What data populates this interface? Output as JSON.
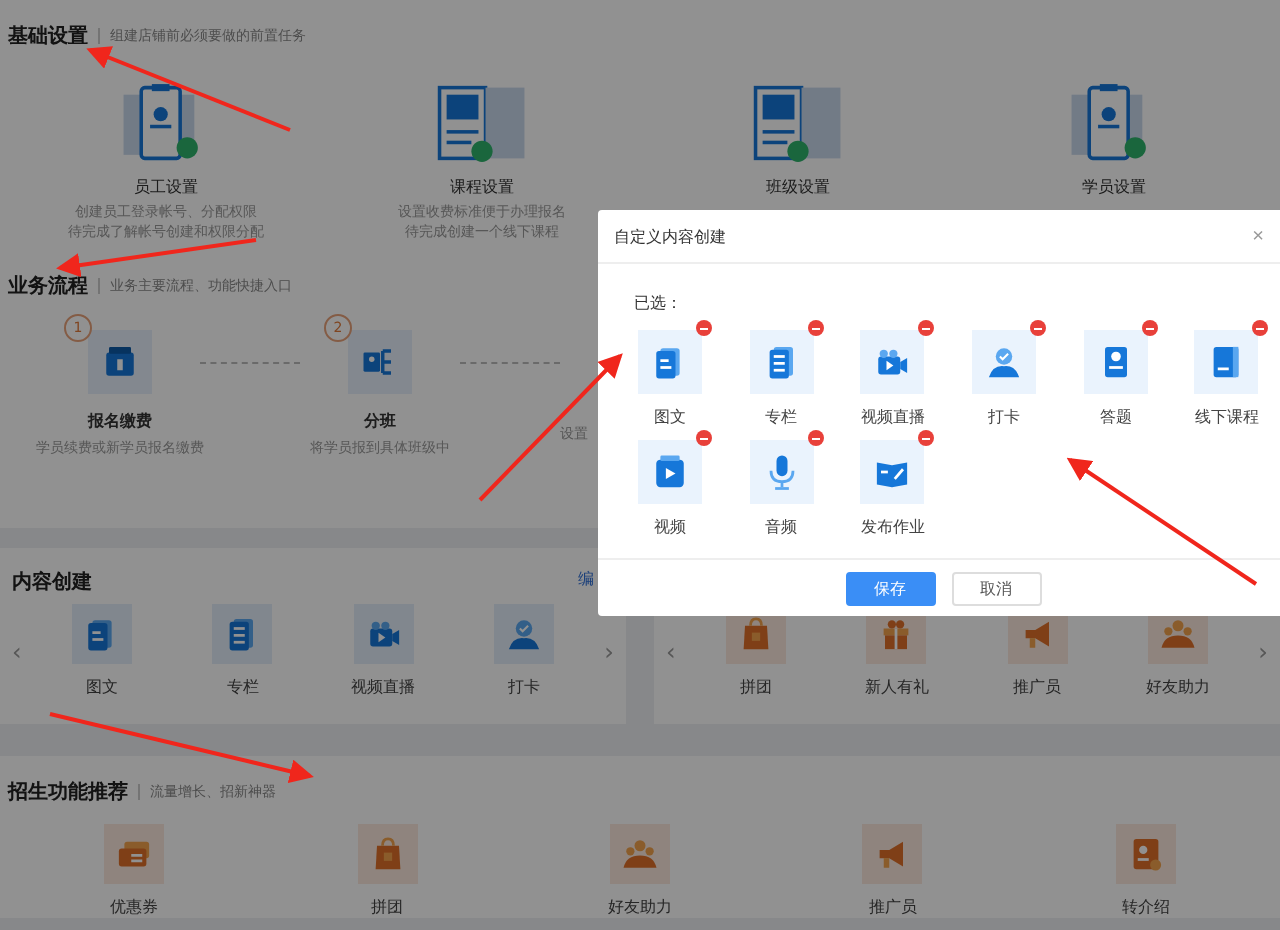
{
  "basic_setup": {
    "title": "基础设置",
    "subtitle": "组建店铺前必须要做的前置任务",
    "cards": [
      {
        "title": "员工设置",
        "lines": [
          "创建员工登录帐号、分配权限",
          "待完成了解帐号创建和权限分配"
        ]
      },
      {
        "title": "课程设置",
        "lines": [
          "设置收费标准便于办理报名",
          "待完成创建一个线下课程"
        ]
      },
      {
        "title": "班级设置"
      },
      {
        "title": "学员设置"
      }
    ]
  },
  "business_flow": {
    "title": "业务流程",
    "subtitle": "业务主要流程、功能快捷入口",
    "steps": [
      {
        "number": "1",
        "title": "报名缴费",
        "desc": "学员续费或新学员报名缴费"
      },
      {
        "number": "2",
        "title": "分班",
        "desc": "将学员报到具体班级中"
      }
    ],
    "cut_text": "设置"
  },
  "content_creation": {
    "title": "内容创建",
    "link": "编",
    "prev": "‹",
    "next": "›",
    "items": [
      {
        "label": "图文"
      },
      {
        "label": "专栏"
      },
      {
        "label": "视频直播"
      },
      {
        "label": "打卡"
      }
    ]
  },
  "marketing_panel": {
    "prev": "‹",
    "next": "›",
    "items": [
      {
        "label": "拼团"
      },
      {
        "label": "新人有礼"
      },
      {
        "label": "推广员"
      },
      {
        "label": "好友助力"
      }
    ]
  },
  "enrollment": {
    "title": "招生功能推荐",
    "subtitle": "流量增长、招新神器",
    "items": [
      {
        "label": "优惠券"
      },
      {
        "label": "拼团"
      },
      {
        "label": "好友助力"
      },
      {
        "label": "推广员"
      },
      {
        "label": "转介绍"
      }
    ]
  },
  "dialog": {
    "title": "自定义内容创建",
    "close": "×",
    "selected_label": "已选：",
    "items": [
      {
        "label": "图文"
      },
      {
        "label": "专栏"
      },
      {
        "label": "视频直播"
      },
      {
        "label": "打卡"
      },
      {
        "label": "答题"
      },
      {
        "label": "线下课程"
      },
      {
        "label": "视频"
      },
      {
        "label": "音频"
      },
      {
        "label": "发布作业"
      }
    ],
    "buttons": [
      {
        "label": "保存",
        "kind": "primary"
      },
      {
        "label": "取消",
        "kind": "default"
      }
    ]
  }
}
